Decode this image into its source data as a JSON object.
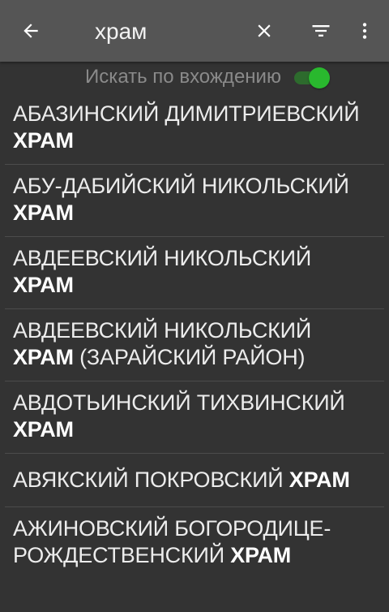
{
  "toolbar": {
    "search_value": "храм",
    "back_icon": "arrow-left-icon",
    "clear_icon": "close-icon",
    "filter_icon": "filter-icon",
    "more_icon": "more-vert-icon",
    "background": "#555555"
  },
  "search_option": {
    "label": "Искать по вхождению",
    "toggle_on": true,
    "toggle_color": "#29b82e"
  },
  "results": [
    {
      "before": "АБАЗИНСКИЙ ДИМИТРИЕВСКИЙ ",
      "match": "ХРАМ",
      "after": ""
    },
    {
      "before": "АБУ-ДАБИЙСКИЙ НИКОЛЬСКИЙ ",
      "match": "ХРАМ",
      "after": ""
    },
    {
      "before": "АВДЕЕВСКИЙ НИКОЛЬСКИЙ ",
      "match": "ХРАМ",
      "after": ""
    },
    {
      "before": "АВДЕЕВСКИЙ НИКОЛЬСКИЙ ",
      "match": "ХРАМ",
      "after": " (ЗАРАЙСКИЙ РАЙОН)"
    },
    {
      "before": "АВДОТЬИНСКИЙ ТИХВИНСКИЙ ",
      "match": "ХРАМ",
      "after": ""
    },
    {
      "before": "АВЯКСКИЙ ПОКРОВСКИЙ ",
      "match": "ХРАМ",
      "after": ""
    },
    {
      "before": "АЖИНОВСКИЙ БОГОРОДИЦЕ-РОЖДЕСТВЕНСКИЙ ",
      "match": "ХРАМ",
      "after": ""
    }
  ]
}
